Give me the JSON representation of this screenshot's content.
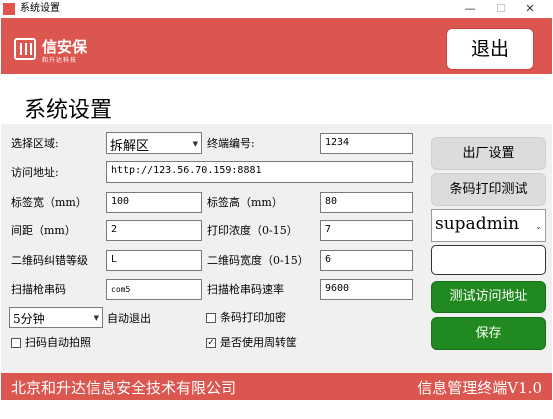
{
  "window": {
    "title": "系统设置",
    "minimize": "—",
    "maximize": "☐",
    "close": "✕"
  },
  "header": {
    "brand": "信安保",
    "brand_sub": "和升达科技",
    "exit_label": "退出",
    "colors": {
      "brand_red": "#dc5650",
      "green": "#20891f"
    }
  },
  "page_title": "系统设置",
  "form": {
    "region_label": "选择区域:",
    "region_value": "拆解区",
    "terminal_no_label": "终端编号:",
    "terminal_no_value": "1234",
    "url_label": "访问地址:",
    "url_value": "http://123.56.70.159:8881",
    "label_width_label": "标签宽（mm）",
    "label_width_value": "100",
    "label_height_label": "标签高（mm）",
    "label_height_value": "80",
    "gap_label": "间距（mm）",
    "gap_value": "2",
    "print_density_label": "打印浓度（0-15）",
    "print_density_value": "7",
    "qr_ecc_label": "二维码纠错等级",
    "qr_ecc_value": "L",
    "qr_width_label": "二维码宽度（0-15）",
    "qr_width_value": "6",
    "scanner_port_label": "扫描枪串码",
    "scanner_port_value": "com5",
    "scanner_baud_label": "扫描枪串码速率",
    "scanner_baud_value": "9600",
    "auto_exit_value": "5分钟",
    "auto_exit_label": "自动退出",
    "barcode_encrypt_label": "条码打印加密",
    "barcode_encrypt_checked": false,
    "scan_autophoto_label": "扫码自动拍照",
    "scan_autophoto_checked": false,
    "turnover_label": "是否使用周转筐",
    "turnover_checked": true,
    "checkmark": "✓"
  },
  "side": {
    "factory_reset_label": "出厂设置",
    "barcode_test_label": "条码打印测试",
    "user_value": "supadmin",
    "password_value": "",
    "test_url_label": "测试访问地址",
    "save_label": "保存"
  },
  "footer": {
    "company": "北京和升达信息安全技术有限公司",
    "terminal": "信息管理终端V1.0"
  }
}
